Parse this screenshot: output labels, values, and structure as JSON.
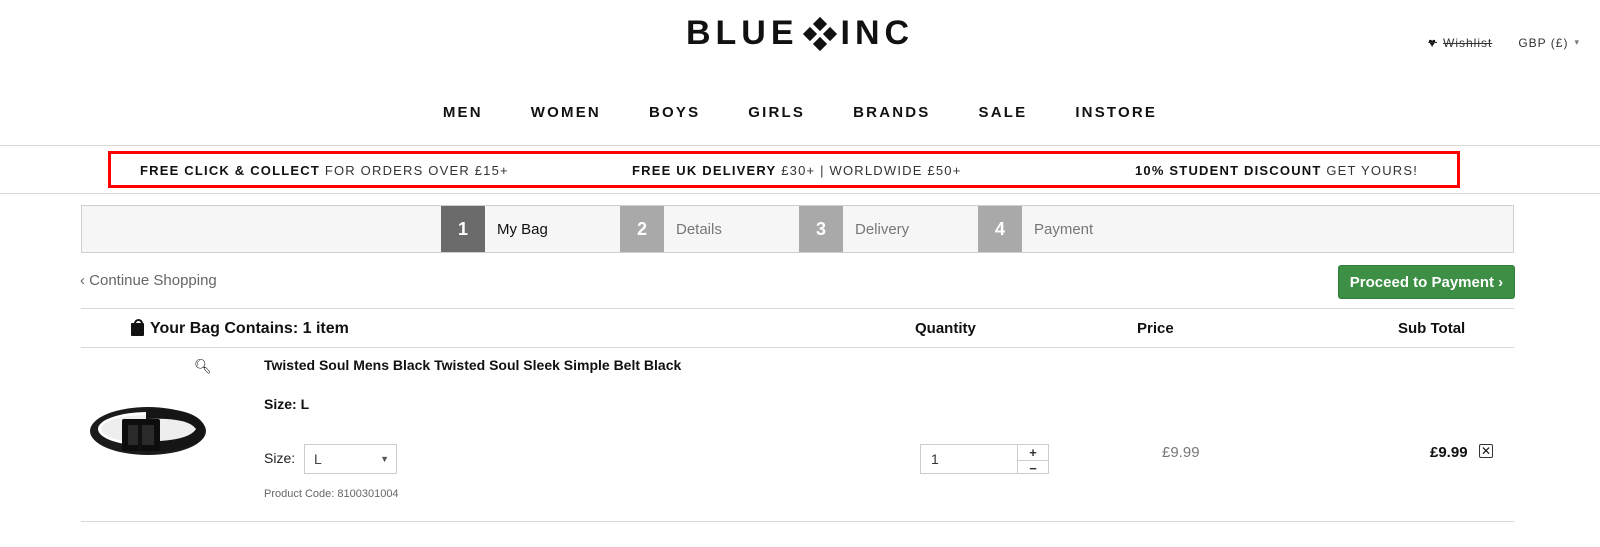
{
  "header": {
    "logo_left": "BLUE",
    "logo_right": "INC",
    "wishlist_label": "Wishlist",
    "currency_label": "GBP (£)"
  },
  "nav": {
    "items": [
      "MEN",
      "WOMEN",
      "BOYS",
      "GIRLS",
      "BRANDS",
      "SALE",
      "INSTORE"
    ]
  },
  "promo": {
    "click_collect_bold": "FREE CLICK & COLLECT",
    "click_collect_light": "FOR ORDERS OVER £15+",
    "delivery_bold": "FREE UK DELIVERY",
    "delivery_light": "£30+ | WORLDWIDE £50+",
    "student_bold": "10% STUDENT DISCOUNT",
    "student_light": "GET YOURS!"
  },
  "checkout_steps": [
    {
      "number": "1",
      "label": "My Bag",
      "active": true
    },
    {
      "number": "2",
      "label": "Details",
      "active": false
    },
    {
      "number": "3",
      "label": "Delivery",
      "active": false
    },
    {
      "number": "4",
      "label": "Payment",
      "active": false
    }
  ],
  "actions": {
    "continue_label": "‹ Continue Shopping",
    "proceed_label": "Proceed to Payment ›"
  },
  "bag": {
    "title": "Your Bag Contains: 1 item",
    "columns": {
      "quantity": "Quantity",
      "price": "Price",
      "subtotal": "Sub Total"
    },
    "items": [
      {
        "name": "Twisted Soul Mens Black Twisted Soul Sleek Simple Belt Black",
        "size_text": "Size: L",
        "size_label": "Size:",
        "size_value": "L",
        "product_code": "Product Code: 8100301004",
        "quantity": "1",
        "price": "£9.99",
        "subtotal": "£9.99"
      }
    ]
  },
  "colors": {
    "accent_green": "#3d8f45",
    "promo_highlight": "#ff0000",
    "step_active": "#6b6b6b"
  }
}
